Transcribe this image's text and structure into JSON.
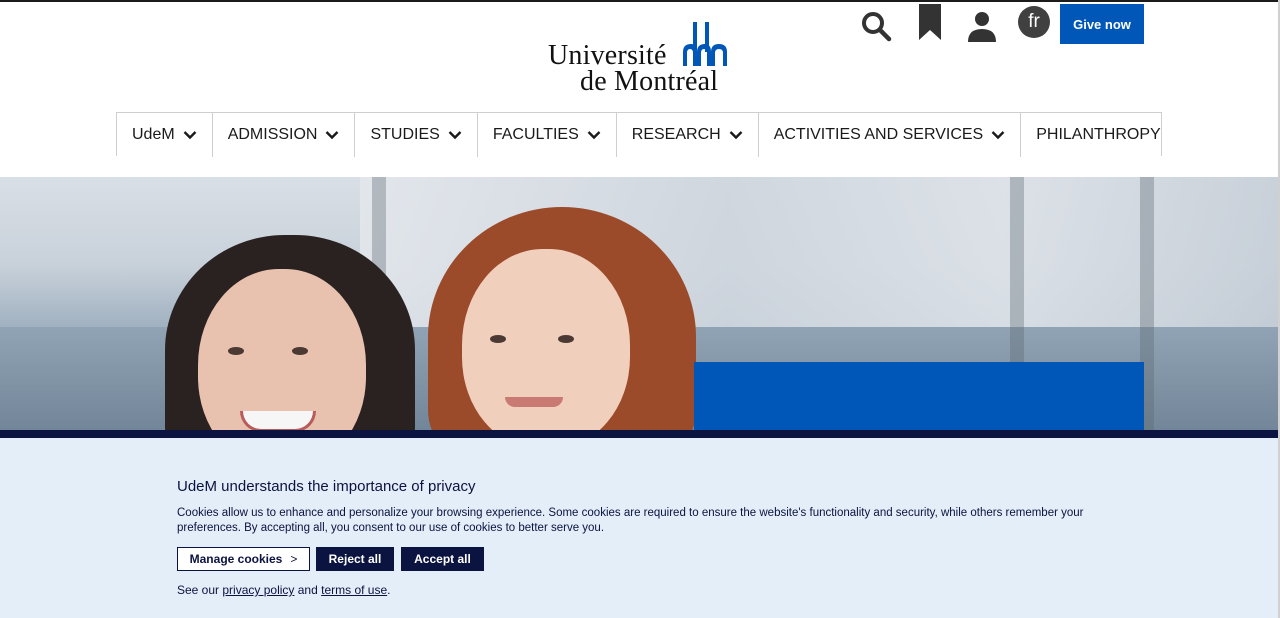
{
  "header": {
    "logo": {
      "line1": "Université",
      "line2": "de Montréal"
    },
    "icons": [
      "search-icon",
      "bookmark-icon",
      "user-icon"
    ],
    "lang_label": "fr",
    "give_label": "Give now"
  },
  "nav": {
    "items": [
      {
        "label": "UdeM",
        "has_dropdown": true
      },
      {
        "label": "ADMISSION",
        "has_dropdown": true
      },
      {
        "label": "STUDIES",
        "has_dropdown": true
      },
      {
        "label": "FACULTIES",
        "has_dropdown": true
      },
      {
        "label": "RESEARCH",
        "has_dropdown": true
      },
      {
        "label": "ACTIVITIES AND SERVICES",
        "has_dropdown": true
      },
      {
        "label": "PHILANTHROPY",
        "has_dropdown": false
      }
    ]
  },
  "cookie": {
    "title": "UdeM understands the importance of privacy",
    "text": "Cookies allow us to enhance and personalize your browsing experience. Some cookies are required to ensure the website's functionality and security, while others remember your preferences. By accepting all, you consent to our use of cookies to better serve you.",
    "manage_label": "Manage cookies",
    "manage_arrow": ">",
    "reject_label": "Reject all",
    "accept_label": "Accept all",
    "footer_prefix": "See our",
    "privacy_link": "privacy policy",
    "footer_and": "and",
    "terms_link": "terms of use",
    "footer_suffix": "."
  },
  "colors": {
    "brand_blue": "#0057b7",
    "navy": "#0b1340",
    "cookie_bg": "#e3eef8"
  }
}
